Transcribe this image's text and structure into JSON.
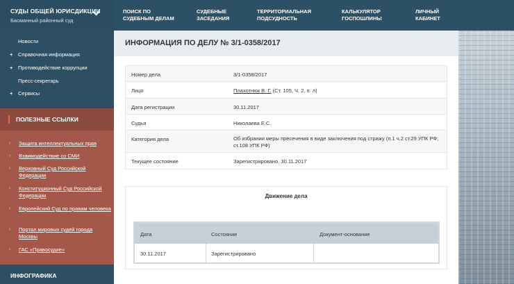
{
  "header": {
    "brand_title": "СУДЫ ОБЩЕЙ ЮРИСДИКЦИИ",
    "brand_subtitle": "Басманный районный суд",
    "nav": [
      {
        "label": "ПОИСК ПО\nСУДЕБНЫМ ДЕЛАМ"
      },
      {
        "label": "СУДЕБНЫЕ\nЗАСЕДАНИЯ"
      },
      {
        "label": "ТЕРРИТОРИАЛЬНАЯ\nПОДСУДНОСТЬ"
      },
      {
        "label": "КАЛЬКУЛЯТОР\nГОСПОШЛИНЫ"
      },
      {
        "label": "ЛИЧНЫЙ\nКАБИНЕТ"
      }
    ]
  },
  "sidebar": {
    "menu": [
      {
        "label": "Новости",
        "plus": ""
      },
      {
        "label": "Справочная информация",
        "plus": "+"
      },
      {
        "label": "Противодействие коррупции",
        "plus": "+"
      },
      {
        "label": "Пресс-секретарь",
        "plus": ""
      },
      {
        "label": "Сервисы",
        "plus": "+"
      }
    ],
    "links_title": "ПОЛЕЗНЫЕ ССЫЛКИ",
    "links": [
      {
        "label": "Защита интеллектуальных прав"
      },
      {
        "label": "Взаимодействие со СМИ"
      },
      {
        "label": "Верховный Суд Российской Федерации"
      },
      {
        "label": "Конституционный Суд Российской Федерации"
      },
      {
        "label": "Европейский Суд по правам человека"
      },
      {
        "label": "Портал мировых судей города Москвы"
      },
      {
        "label": "ГАС «Правосудие»"
      }
    ],
    "infographics_title": "ИНФОГРАФИКА"
  },
  "main": {
    "title": "ИНФОРМАЦИЯ ПО ДЕЛУ № 3/1-0358/2017",
    "case_rows": [
      {
        "label": "Номер дела",
        "value": "3/1-0358/2017"
      },
      {
        "label": "Лицо",
        "value_link": "Плахотнюк В. Г.",
        "value": " (Ст. 105, Ч. 2, п. л)"
      },
      {
        "label": "Дата регистрации",
        "value": "30.11.2017"
      },
      {
        "label": "Судья",
        "value": "Николаева Е.С."
      },
      {
        "label": "Категория дела",
        "value": "Об избрании меры пресечения в виде заключения под стражу (п.1 ч.2 ст.29 УПК РФ; ст.108 УПК РФ)"
      },
      {
        "label": "Текущее состояние",
        "value": "Зарегистрировано, 30.11.2017"
      }
    ],
    "movement": {
      "title": "Движение дела",
      "columns": [
        "Дата",
        "Состояние",
        "Документ-основание"
      ],
      "rows": [
        {
          "date": "30.11.2017",
          "state": "Зарегистрировано",
          "document": ""
        }
      ]
    }
  }
}
